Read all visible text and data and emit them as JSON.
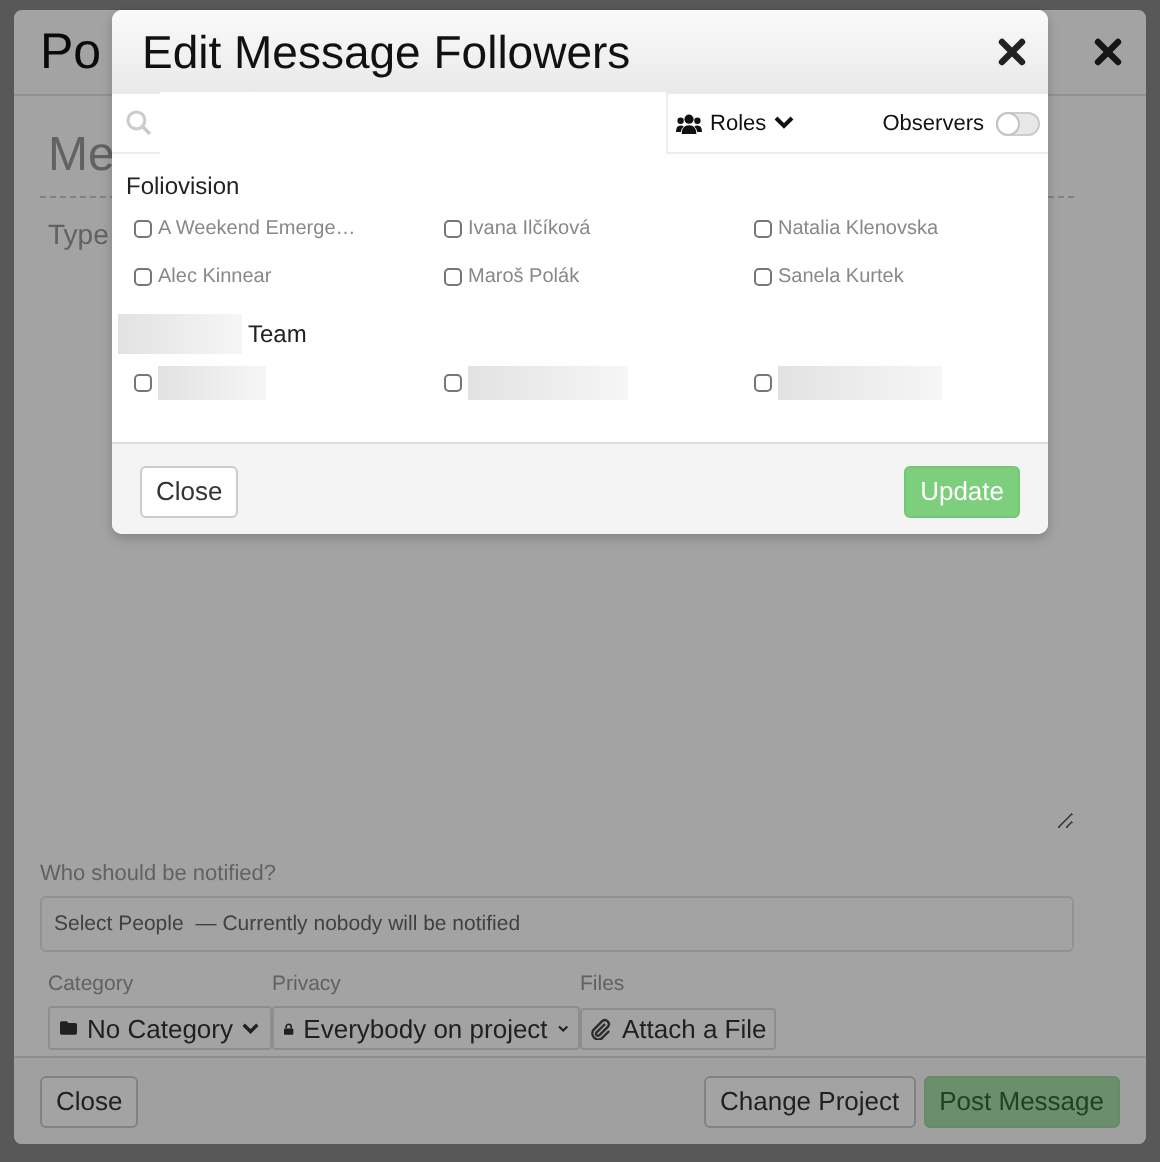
{
  "post_dialog": {
    "title": "Po",
    "subject": {
      "placeholder": "Me"
    },
    "body": {
      "placeholder": "Type"
    },
    "notify": {
      "label": "Who should be notified?",
      "select": "Select People",
      "status": "— Currently nobody will be notified"
    },
    "fields": [
      {
        "label": "Category",
        "value": "No Category",
        "kind": "select"
      },
      {
        "label": "Privacy",
        "value": "Everybody on project",
        "kind": "select"
      },
      {
        "label": "Files",
        "value": "Attach a File",
        "kind": "button"
      }
    ],
    "buttons": [
      {
        "label": "Close",
        "kind": "default",
        "disabled": false
      },
      {
        "label": "Change Project",
        "kind": "default",
        "disabled": false
      },
      {
        "label": "Post Message",
        "kind": "primary",
        "disabled": true
      }
    ]
  },
  "followers_dialog": {
    "title": "Edit Message Followers",
    "roles_menu": "Roles",
    "observers": {
      "label": "Observers",
      "on": false
    },
    "groups": [
      {
        "name": "Foliovision",
        "name_redacted": false,
        "members": [
          {
            "kind": "person",
            "name": "A Weekend Emerge…",
            "checked": false
          },
          {
            "kind": "person",
            "name": "Ivana Ilčíková",
            "checked": false
          },
          {
            "kind": "person",
            "name": "Natalia Klenovska",
            "checked": false
          },
          {
            "kind": "person",
            "name": "Alec Kinnear",
            "checked": false
          },
          {
            "kind": "person",
            "name": "Maroš Polák",
            "checked": false
          },
          {
            "kind": "person",
            "name": "Sanela Kurtek",
            "checked": false
          }
        ]
      },
      {
        "name": "Team",
        "name_redacted": true,
        "members": [
          {
            "kind": "redacted",
            "checked": false
          },
          {
            "kind": "redacted",
            "checked": false
          },
          {
            "kind": "redacted",
            "checked": false
          }
        ]
      }
    ],
    "buttons": [
      {
        "label": "Close",
        "kind": "default"
      },
      {
        "label": "Update",
        "kind": "primary"
      }
    ]
  }
}
